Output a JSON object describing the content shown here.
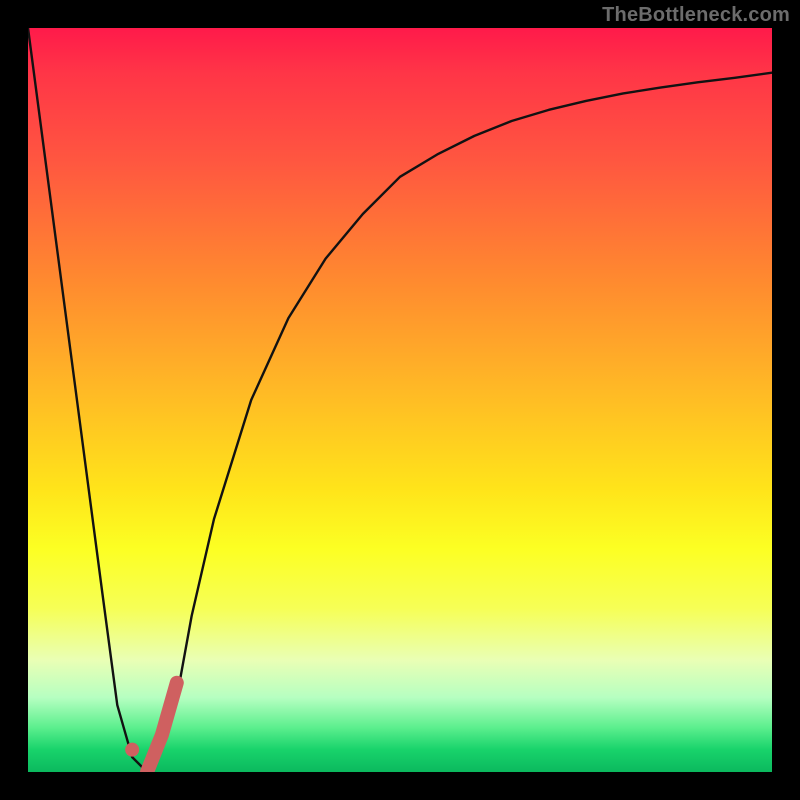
{
  "watermark": "TheBottleneck.com",
  "colors": {
    "black": "#000000",
    "curve": "#121212",
    "marker": "#cf6060",
    "gradient_top": "#ff1a4a",
    "gradient_bottom": "#0bb95e"
  },
  "chart_data": {
    "type": "line",
    "title": "",
    "xlabel": "",
    "ylabel": "",
    "xlim": [
      0,
      100
    ],
    "ylim": [
      0,
      100
    ],
    "grid": false,
    "legend": false,
    "series": [
      {
        "name": "bottleneck-curve",
        "x": [
          0,
          5,
          10,
          12,
          14,
          16,
          18,
          20,
          22,
          25,
          30,
          35,
          40,
          45,
          50,
          55,
          60,
          65,
          70,
          75,
          80,
          85,
          90,
          95,
          100
        ],
        "values": [
          100,
          62,
          24,
          9,
          2,
          0,
          3,
          10,
          21,
          34,
          50,
          61,
          69,
          75,
          80,
          83,
          85.5,
          87.5,
          89,
          90.2,
          91.2,
          92,
          92.7,
          93.3,
          94
        ]
      },
      {
        "name": "marker-segment",
        "x": [
          16,
          18,
          20
        ],
        "values": [
          0,
          5,
          12
        ]
      }
    ],
    "annotations": [
      {
        "name": "marker-dot",
        "x": 14,
        "y": 3
      }
    ]
  }
}
